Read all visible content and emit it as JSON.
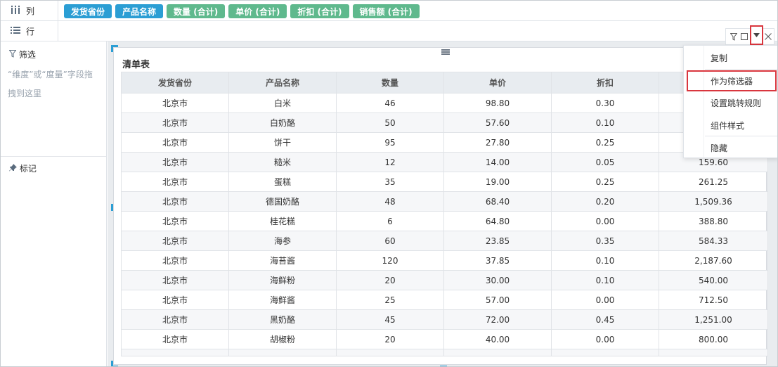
{
  "shelves": {
    "columns_label": "列",
    "rows_label": "行",
    "column_fields": [
      {
        "label": "发货省份",
        "kind": "dimension"
      },
      {
        "label": "产品名称",
        "kind": "dimension"
      },
      {
        "label": "数量 (合计)",
        "kind": "measure"
      },
      {
        "label": "单价 (合计)",
        "kind": "measure"
      },
      {
        "label": "折扣 (合计)",
        "kind": "measure"
      },
      {
        "label": "销售额 (合计)",
        "kind": "measure"
      }
    ]
  },
  "left_panel": {
    "filter_title": "筛选",
    "filter_hint": "“维度”或“度量”字段拖拽到这里",
    "mark_title": "标记"
  },
  "widget": {
    "title": "清单表",
    "headers": [
      "发货省份",
      "产品名称",
      "数量",
      "单价",
      "折扣",
      ""
    ],
    "rows": [
      [
        "北京市",
        "白米",
        "46",
        "98.80",
        "0.30",
        ""
      ],
      [
        "北京市",
        "白奶酪",
        "50",
        "57.60",
        "0.10",
        ""
      ],
      [
        "北京市",
        "饼干",
        "95",
        "27.80",
        "0.25",
        ""
      ],
      [
        "北京市",
        "糙米",
        "12",
        "14.00",
        "0.05",
        "159.60"
      ],
      [
        "北京市",
        "蛋糕",
        "35",
        "19.00",
        "0.25",
        "261.25"
      ],
      [
        "北京市",
        "德国奶酪",
        "48",
        "68.40",
        "0.20",
        "1,509.36"
      ],
      [
        "北京市",
        "桂花糕",
        "6",
        "64.80",
        "0.00",
        "388.80"
      ],
      [
        "北京市",
        "海参",
        "60",
        "23.85",
        "0.35",
        "584.33"
      ],
      [
        "北京市",
        "海苔酱",
        "120",
        "37.85",
        "0.10",
        "2,187.60"
      ],
      [
        "北京市",
        "海鲜粉",
        "20",
        "30.00",
        "0.10",
        "540.00"
      ],
      [
        "北京市",
        "海鲜酱",
        "25",
        "57.00",
        "0.00",
        "712.50"
      ],
      [
        "北京市",
        "黑奶酪",
        "45",
        "72.00",
        "0.45",
        "1,251.00"
      ],
      [
        "北京市",
        "胡椒粉",
        "20",
        "40.00",
        "0.00",
        "800.00"
      ]
    ]
  },
  "menu": {
    "items": [
      "复制",
      "作为筛选器",
      "设置跳转规则",
      "组件样式",
      "隐藏"
    ],
    "highlighted": "作为筛选器"
  },
  "icons": {
    "columns": "columns-icon",
    "rows": "list-icon",
    "filter": "filter-icon",
    "mark": "pin-icon",
    "toolbar": [
      "filter-icon",
      "maximize-icon",
      "dropdown-icon",
      "close-icon"
    ]
  },
  "colors": {
    "dimension_pill": "#2b9ed4",
    "measure_pill": "#5fb98d",
    "highlight": "#d9363e"
  }
}
